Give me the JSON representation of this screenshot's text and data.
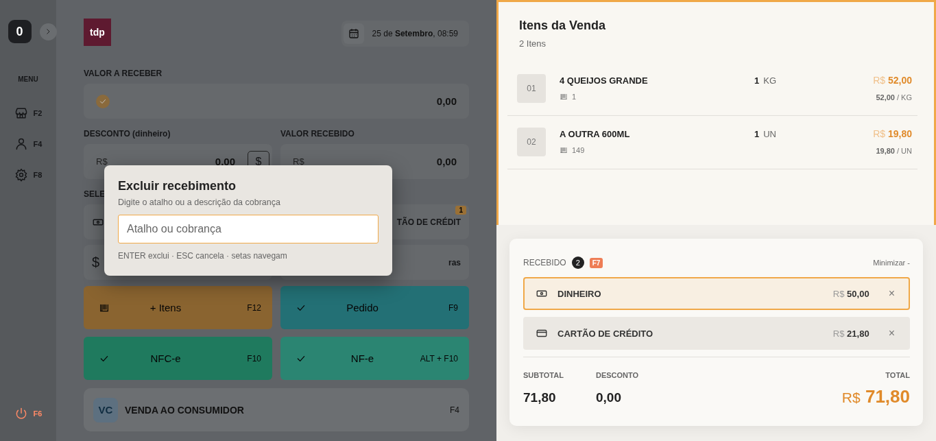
{
  "sidebar": {
    "counter": "0",
    "menu_label": "MENU",
    "items": [
      {
        "kind": "store",
        "key": "F2"
      },
      {
        "kind": "user",
        "key": "F4"
      },
      {
        "kind": "gear",
        "key": "F8"
      }
    ],
    "logout_key": "F6"
  },
  "header": {
    "logo": "tdp",
    "date": "25 de **Setembro**, 08:59"
  },
  "valor_a_receber": {
    "label": "VALOR A RECEBER",
    "value": "0,00"
  },
  "desconto": {
    "label": "DESCONTO (dinheiro)",
    "currency": "R$",
    "value": "0,00",
    "button": "$"
  },
  "valor_recebido": {
    "label": "VALOR RECEBIDO",
    "currency": "R$",
    "value": "0,00"
  },
  "payment_section": {
    "label": "SELE",
    "options": [
      {
        "kind": "cash"
      },
      {
        "kind": "card",
        "label": "TÃO DE CRÉDIT",
        "badge": "1"
      },
      {
        "kind": "dollar",
        "icon": "$"
      },
      {
        "kind": "other",
        "label": "ras"
      }
    ]
  },
  "actions": [
    {
      "kind": "barcode",
      "label": "+ Itens",
      "key": "F12",
      "color": "#8a6430"
    },
    {
      "kind": "check",
      "label": "Pedido",
      "key": "F9",
      "color": "#237075"
    },
    {
      "kind": "check",
      "label": "NFC-e",
      "key": "F10",
      "color": "#1f7a5e"
    },
    {
      "kind": "check",
      "label": "NF-e",
      "key": "ALT + F10",
      "color": "#2b8572"
    }
  ],
  "customer": {
    "initials": "VC",
    "name": "VENDA AO CONSUMIDOR",
    "key": "F4"
  },
  "modal": {
    "title": "Excluir recebimento",
    "subtitle": "Digite o atalho ou a descrição da cobrança",
    "placeholder": "Atalho ou cobrança",
    "hint": "ENTER exclui · ESC cancela · setas navegam"
  },
  "sale_items": {
    "title": "Itens da Venda",
    "count": "2 Itens",
    "items": [
      {
        "index": "01",
        "name": "4 QUEIJOS GRANDE",
        "code": "1",
        "qty": "1",
        "unit": "KG",
        "currency": "R$",
        "total": "52,00",
        "unit_price": "52,00",
        "unit_label": "/ KG"
      },
      {
        "index": "02",
        "name": "A OUTRA 600ML",
        "code": "149",
        "qty": "1",
        "unit": "UN",
        "currency": "R$",
        "total": "19,80",
        "unit_price": "19,80",
        "unit_label": "/ UN"
      }
    ]
  },
  "received": {
    "label": "RECEBIDO",
    "count": "2",
    "key": "F7",
    "minimize": "Minimizar -",
    "payments": [
      {
        "kind": "cash",
        "name": "DINHEIRO",
        "currency": "R$",
        "amount": "50,00",
        "selected": true,
        "remove": "×"
      },
      {
        "kind": "card",
        "name": "CARTÃO DE CRÉDITO",
        "currency": "R$",
        "amount": "21,80",
        "selected": false,
        "remove": "×"
      }
    ]
  },
  "totals": {
    "subtotal_label": "SUBTOTAL",
    "subtotal": "71,80",
    "discount_label": "DESCONTO",
    "discount": "0,00",
    "total_label": "TOTAL",
    "currency": "R$",
    "total": "71,80"
  }
}
